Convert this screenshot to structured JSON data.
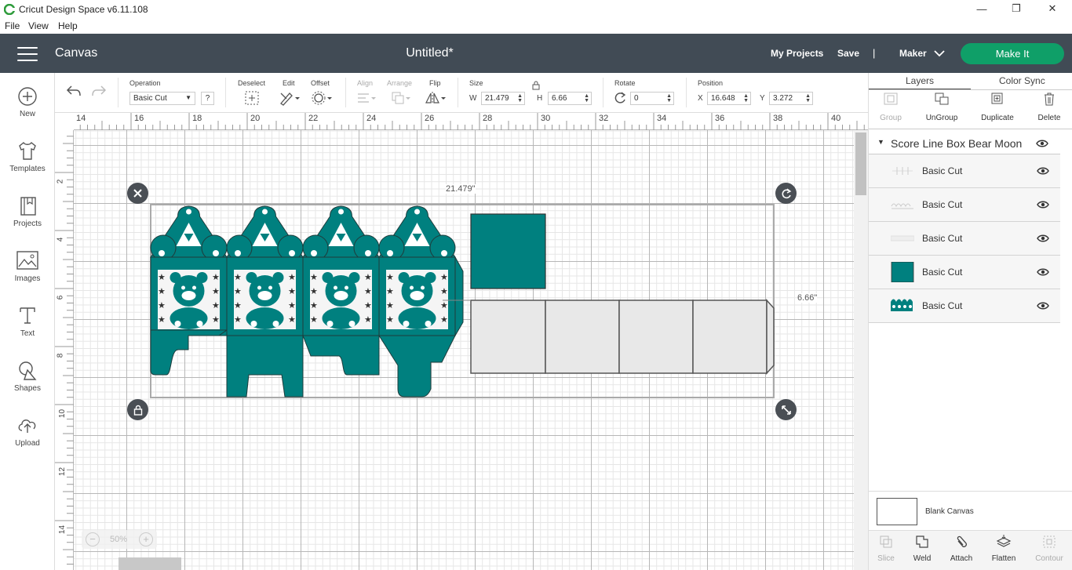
{
  "window": {
    "title": "Cricut Design Space  v6.11.108",
    "minimize": "—",
    "maximize": "❐",
    "close": "✕"
  },
  "menu": {
    "file": "File",
    "view": "View",
    "help": "Help"
  },
  "header": {
    "section": "Canvas",
    "doc_title": "Untitled*",
    "my_projects": "My Projects",
    "save": "Save",
    "separator": "|",
    "machine": "Maker",
    "make_it": "Make It"
  },
  "nav": {
    "new": "New",
    "templates": "Templates",
    "projects": "Projects",
    "images": "Images",
    "text": "Text",
    "shapes": "Shapes",
    "upload": "Upload"
  },
  "toolbar": {
    "operation_label": "Operation",
    "operation_value": "Basic Cut",
    "help": "?",
    "deselect": "Deselect",
    "edit": "Edit",
    "offset": "Offset",
    "align": "Align",
    "arrange": "Arrange",
    "flip": "Flip",
    "size": "Size",
    "w_label": "W",
    "w_value": "21.479",
    "h_label": "H",
    "h_value": "6.66",
    "rotate": "Rotate",
    "rotate_value": "0",
    "position": "Position",
    "x_label": "X",
    "x_value": "16.648",
    "y_label": "Y",
    "y_value": "3.272"
  },
  "ruler": {
    "top": [
      "14",
      "16",
      "18",
      "20",
      "22",
      "24",
      "26",
      "28",
      "30",
      "32",
      "34",
      "36",
      "38",
      "40"
    ],
    "left": [
      "2",
      "4",
      "6",
      "8",
      "10",
      "12",
      "14"
    ]
  },
  "canvas": {
    "width_label": "21.479\"",
    "height_label": "6.66\"",
    "teal": "#00807f",
    "panel_gray": "#e8e8e8"
  },
  "zoom": {
    "minus": "−",
    "level": "50%",
    "plus": "+"
  },
  "panel": {
    "tabs": {
      "layers": "Layers",
      "color_sync": "Color Sync"
    },
    "actions": {
      "group": "Group",
      "ungroup": "UnGroup",
      "duplicate": "Duplicate",
      "delete": "Delete"
    },
    "group_name": "Score Line Box Bear Moon",
    "layers": [
      {
        "name": "Basic Cut",
        "thumb": "score-lines"
      },
      {
        "name": "Basic Cut",
        "thumb": "scallop-lines"
      },
      {
        "name": "Basic Cut",
        "thumb": "light-strip"
      },
      {
        "name": "Basic Cut",
        "thumb": "teal-square"
      },
      {
        "name": "Basic Cut",
        "thumb": "teal-box"
      }
    ],
    "blank_canvas": "Blank Canvas",
    "bottom": {
      "slice": "Slice",
      "weld": "Weld",
      "attach": "Attach",
      "flatten": "Flatten",
      "contour": "Contour"
    }
  }
}
